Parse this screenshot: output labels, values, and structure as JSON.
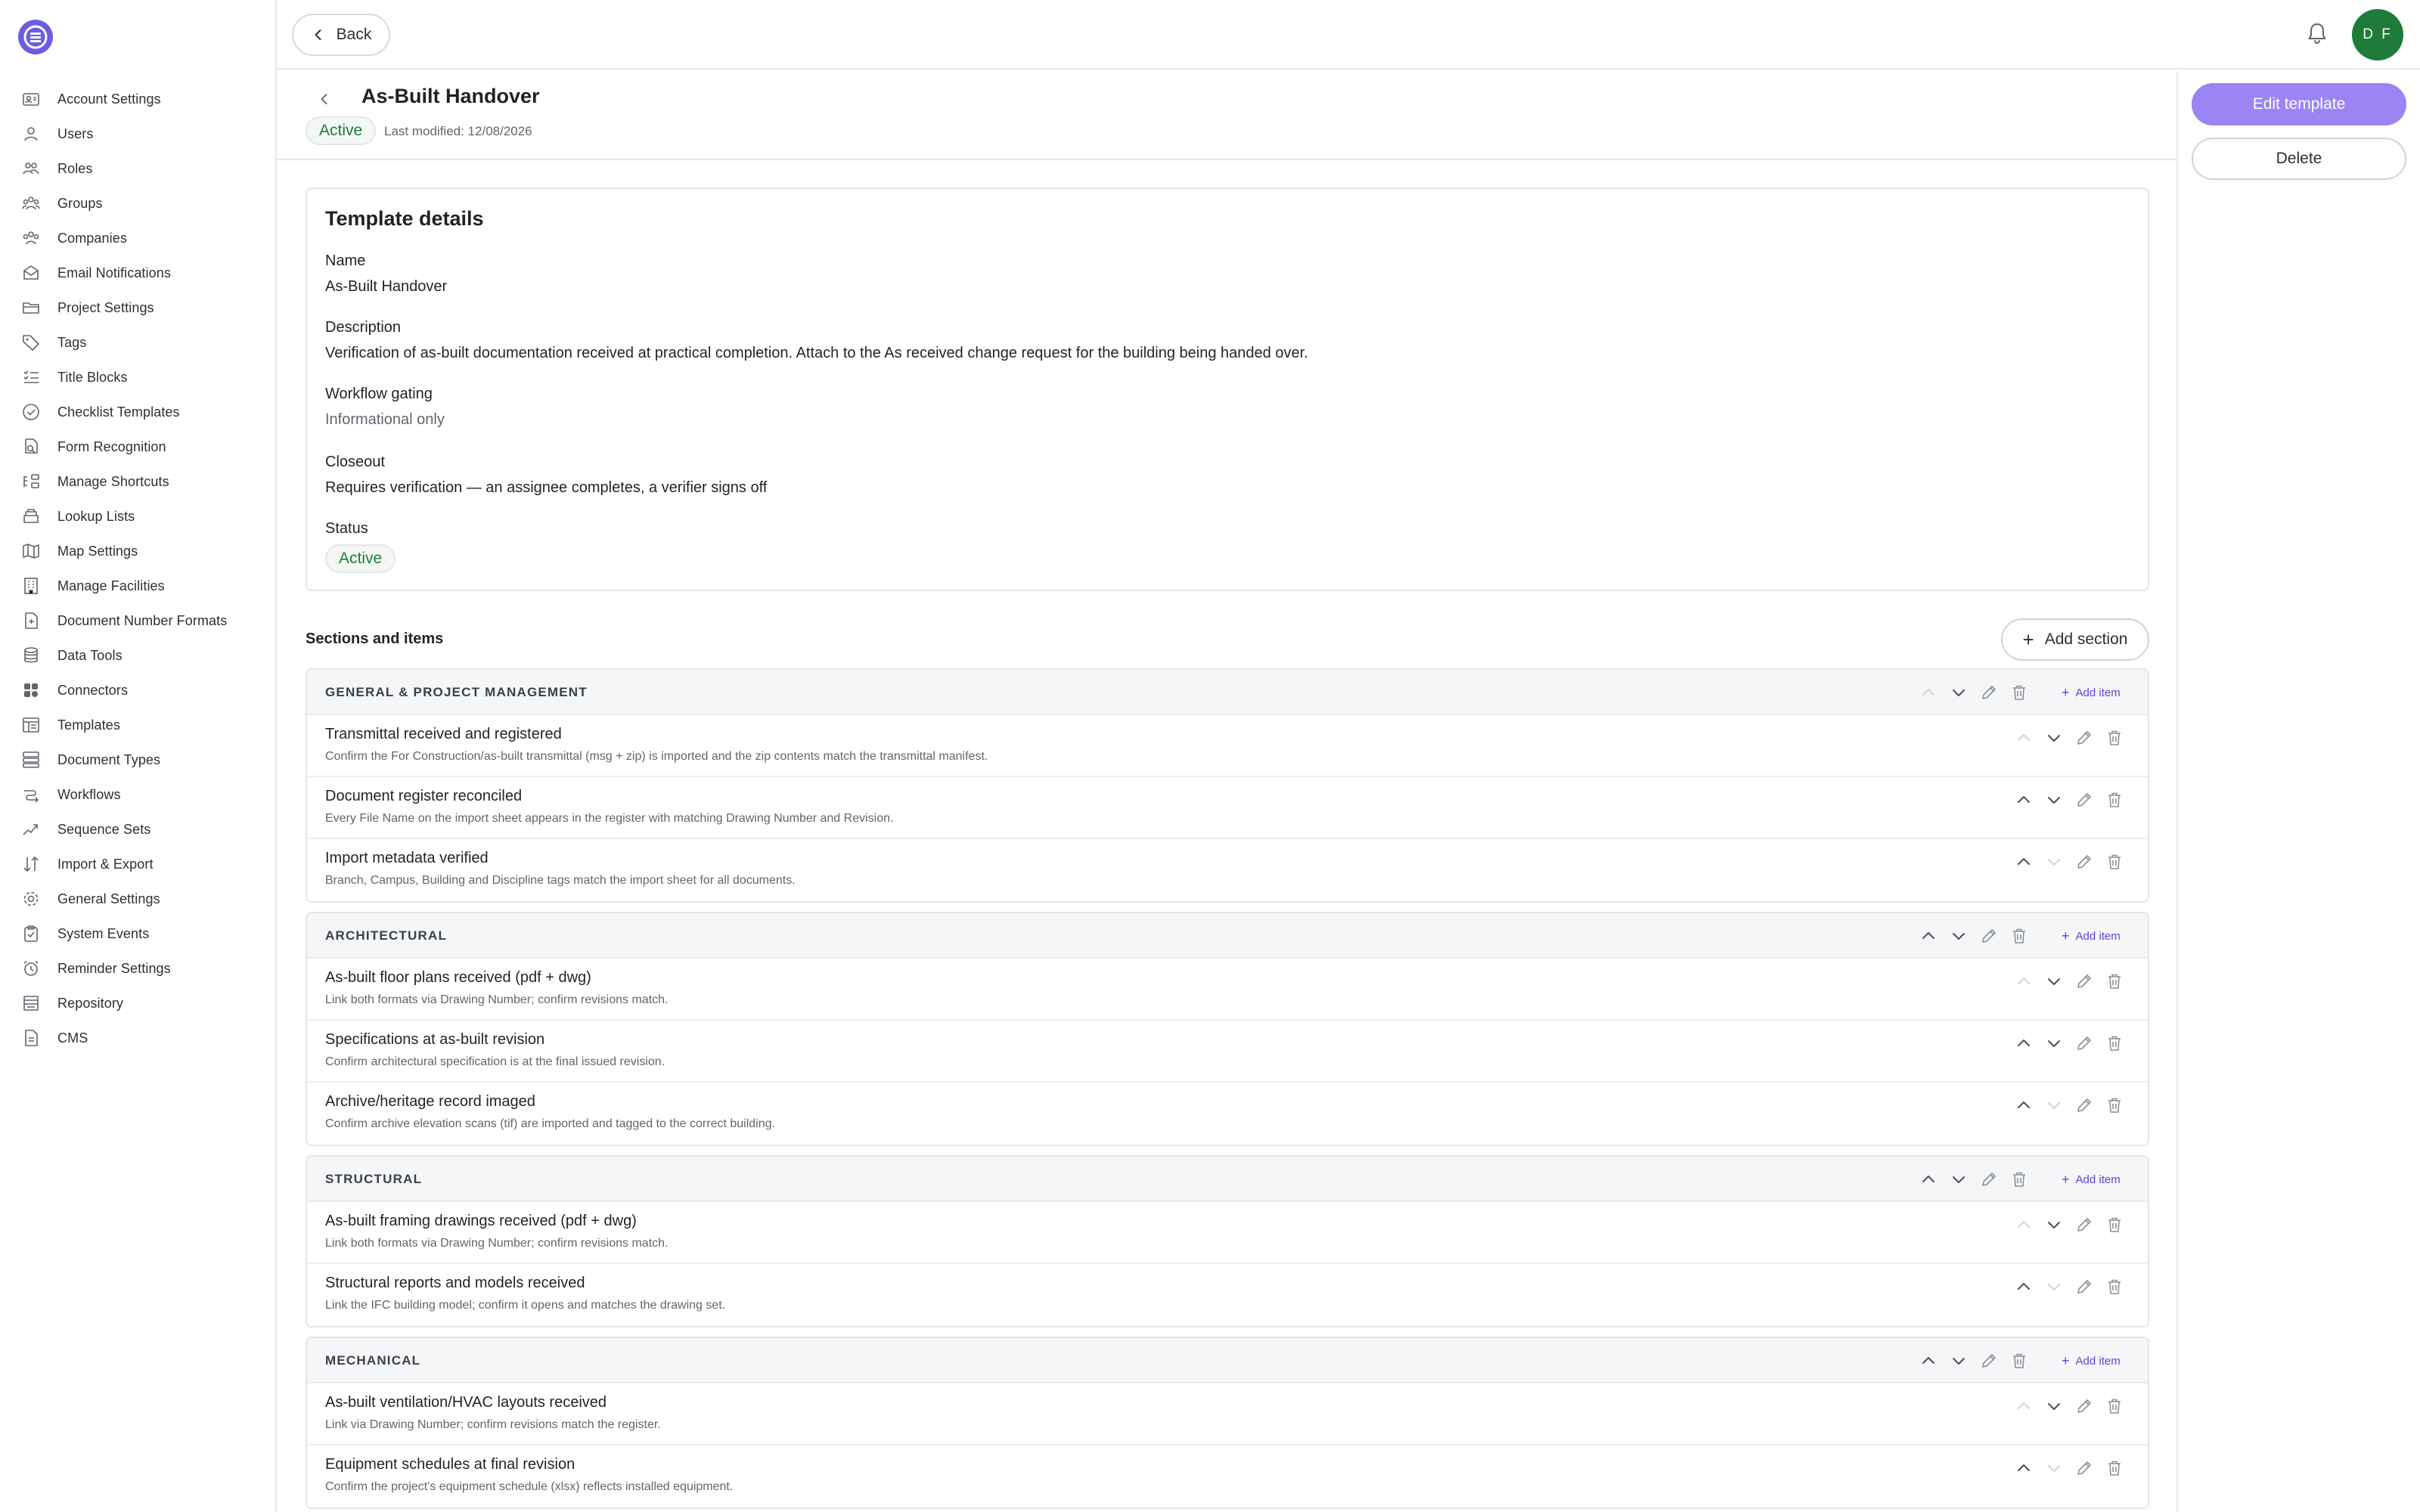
{
  "sidebar": {
    "items": [
      {
        "label": "Account Settings",
        "icon": "account-settings-icon"
      },
      {
        "label": "Users",
        "icon": "users-icon"
      },
      {
        "label": "Roles",
        "icon": "roles-icon"
      },
      {
        "label": "Groups",
        "icon": "groups-icon"
      },
      {
        "label": "Companies",
        "icon": "companies-icon"
      },
      {
        "label": "Email Notifications",
        "icon": "email-icon"
      },
      {
        "label": "Project Settings",
        "icon": "folder-icon"
      },
      {
        "label": "Tags",
        "icon": "tag-icon"
      },
      {
        "label": "Title Blocks",
        "icon": "list-icon"
      },
      {
        "label": "Checklist Templates",
        "icon": "check-circle-icon"
      },
      {
        "label": "Form Recognition",
        "icon": "form-recognition-icon"
      },
      {
        "label": "Manage Shortcuts",
        "icon": "shortcuts-icon"
      },
      {
        "label": "Lookup Lists",
        "icon": "lookup-icon"
      },
      {
        "label": "Map Settings",
        "icon": "map-icon"
      },
      {
        "label": "Manage Facilities",
        "icon": "building-icon"
      },
      {
        "label": "Document Number Formats",
        "icon": "document-number-icon"
      },
      {
        "label": "Data Tools",
        "icon": "database-icon"
      },
      {
        "label": "Connectors",
        "icon": "connectors-icon"
      },
      {
        "label": "Templates",
        "icon": "templates-icon"
      },
      {
        "label": "Document Types",
        "icon": "document-types-icon"
      },
      {
        "label": "Workflows",
        "icon": "workflow-icon"
      },
      {
        "label": "Sequence Sets",
        "icon": "sequence-icon"
      },
      {
        "label": "Import & Export",
        "icon": "import-export-icon"
      },
      {
        "label": "General Settings",
        "icon": "gear-icon"
      },
      {
        "label": "System Events",
        "icon": "clipboard-check-icon"
      },
      {
        "label": "Reminder Settings",
        "icon": "alarm-icon"
      },
      {
        "label": "Repository",
        "icon": "repository-icon"
      },
      {
        "label": "CMS",
        "icon": "cms-icon"
      }
    ]
  },
  "topbar": {
    "back_label": "Back",
    "avatar_initials": "D F"
  },
  "header": {
    "title": "As-Built Handover",
    "status": "Active",
    "last_modified": "Last modified: 12/08/2026"
  },
  "actions": {
    "edit_label": "Edit template",
    "delete_label": "Delete"
  },
  "details": {
    "heading": "Template details",
    "name_label": "Name",
    "name_value": "As-Built Handover",
    "description_label": "Description",
    "description_value": "Verification of as-built documentation received at practical completion. Attach to the As received change request for the building being handed over.",
    "gating_label": "Workflow gating",
    "gating_value": "Informational only",
    "closeout_label": "Closeout",
    "closeout_value": "Requires verification — an assignee completes, a verifier signs off",
    "status_label": "Status",
    "status_value": "Active"
  },
  "sections_header": {
    "label": "Sections and items",
    "add_section_label": "Add section"
  },
  "add_item_label": "Add item",
  "sections": [
    {
      "name": "GENERAL & PROJECT MANAGEMENT",
      "items": [
        {
          "title": "Transmittal received and registered",
          "desc": "Confirm the For Construction/as-built transmittal (msg + zip) is imported and the zip contents match the transmittal manifest."
        },
        {
          "title": "Document register reconciled",
          "desc": "Every File Name on the import sheet appears in the register with matching Drawing Number and Revision."
        },
        {
          "title": "Import metadata verified",
          "desc": "Branch, Campus, Building and Discipline tags match the import sheet for all documents."
        }
      ]
    },
    {
      "name": "ARCHITECTURAL",
      "items": [
        {
          "title": "As-built floor plans received (pdf + dwg)",
          "desc": "Link both formats via Drawing Number; confirm revisions match."
        },
        {
          "title": "Specifications at as-built revision",
          "desc": "Confirm architectural specification is at the final issued revision."
        },
        {
          "title": "Archive/heritage record imaged",
          "desc": "Confirm archive elevation scans (tif) are imported and tagged to the correct building."
        }
      ]
    },
    {
      "name": "STRUCTURAL",
      "items": [
        {
          "title": "As-built framing drawings received (pdf + dwg)",
          "desc": "Link both formats via Drawing Number; confirm revisions match."
        },
        {
          "title": "Structural reports and models received",
          "desc": "Link the IFC building model; confirm it opens and matches the drawing set."
        }
      ]
    },
    {
      "name": "MECHANICAL",
      "items": [
        {
          "title": "As-built ventilation/HVAC layouts received",
          "desc": "Link via Drawing Number; confirm revisions match the register."
        },
        {
          "title": "Equipment schedules at final revision",
          "desc": "Confirm the project's equipment schedule (xlsx) reflects installed equipment."
        }
      ]
    }
  ],
  "colors": {
    "accent": "#9a85f2",
    "active_green": "#1e7b3a",
    "link": "#5a44d6"
  }
}
